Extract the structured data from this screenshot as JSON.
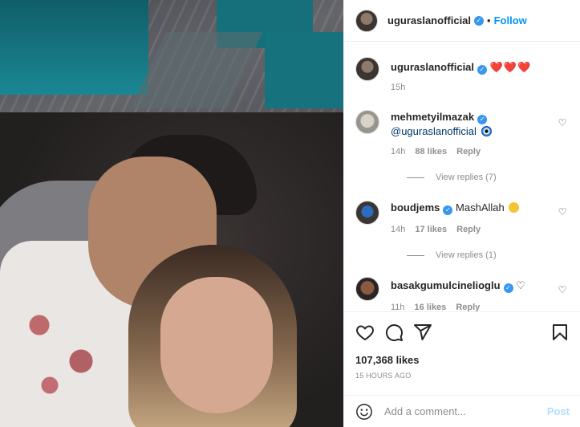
{
  "header": {
    "username": "uguraslanofficial",
    "dot": "•",
    "follow_label": "Follow"
  },
  "caption": {
    "username": "uguraslanofficial",
    "text": "❤️❤️❤️",
    "time": "15h"
  },
  "comments": [
    {
      "username": "mehmetyilmazak",
      "text": "@uguraslanofficial",
      "emoji": "evil-eye",
      "time": "14h",
      "likes": "88 likes",
      "reply_label": "Reply",
      "view_replies": "View replies (7)"
    },
    {
      "username": "boudjems",
      "text": "MashAllah",
      "emoji": "face-blowing-kiss",
      "time": "14h",
      "likes": "17 likes",
      "reply_label": "Reply",
      "view_replies": "View replies (1)"
    },
    {
      "username": "basakgumulcinelioglu",
      "text": "♡",
      "time": "11h",
      "likes": "16 likes",
      "reply_label": "Reply"
    }
  ],
  "actions": {
    "likes_count": "107,368 likes",
    "timestamp": "15 HOURS AGO"
  },
  "comment_box": {
    "placeholder": "Add a comment...",
    "post_label": "Post"
  },
  "colors": {
    "accent": "#0095f6",
    "verified": "#3897f0",
    "muted": "#8e8e8e",
    "heart": "#e0202a"
  }
}
